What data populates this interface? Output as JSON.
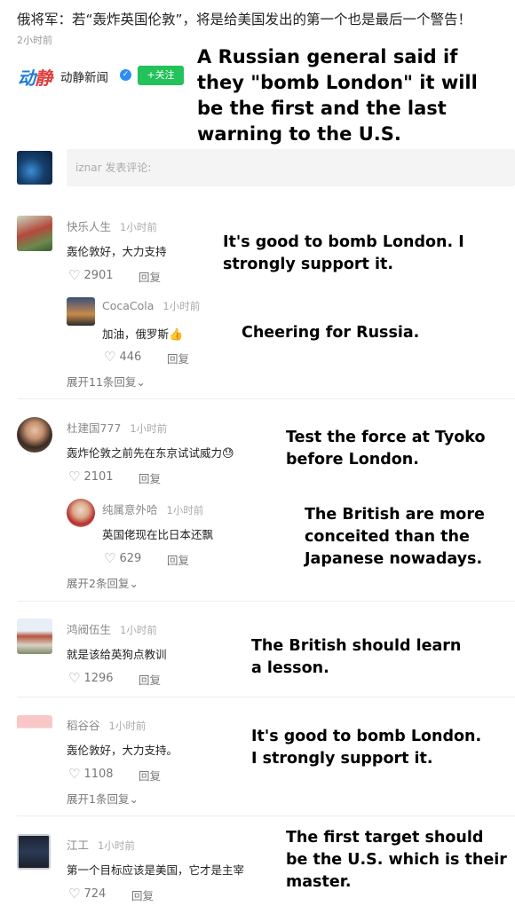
{
  "article": {
    "headline": "俄将军：若“轰炸英国伦敦”，将是给美国发出的第一个也是最后一个警告！",
    "time_ago": "2小时前",
    "source_logo_a": "动",
    "source_logo_b": "静",
    "source_name": "动静新闻",
    "verified_mark": "✓",
    "follow_label": "+关注",
    "caption": "A Russian general said if they \"bomb London\" it will be the first and the last warning to the U.S."
  },
  "comment_input": {
    "placeholder": "iznar 发表评论:"
  },
  "comments": [
    {
      "user": "快乐人生",
      "time": "1小时前",
      "text": "轰伦敦好，大力支持",
      "likes": "2901",
      "reply_label": "回复",
      "caption": "It's good to bomb London. I strongly support it.",
      "replies": [
        {
          "user": "CocaCola",
          "time": "1小时前",
          "text": "加油，俄罗斯",
          "emoji": "👍",
          "likes": "446",
          "reply_label": "回复",
          "caption": "Cheering for Russia."
        }
      ],
      "expand_label": "展开11条回复"
    },
    {
      "user": "杜建国777",
      "time": "1小时前",
      "text": "轰炸伦敦之前先在东京试试威力",
      "emoji": "😓",
      "likes": "2101",
      "reply_label": "回复",
      "caption": "Test the force at Tyoko before London.",
      "replies": [
        {
          "user": "纯属意外哈",
          "time": "1小时前",
          "text": "英国佬现在比日本还飘",
          "likes": "629",
          "reply_label": "回复",
          "caption": "The British are more conceited than the Japanese nowadays."
        }
      ],
      "expand_label": "展开2条回复"
    },
    {
      "user": "鸿阀伍生",
      "time": "1小时前",
      "text": "就是该给英狗点教训",
      "likes": "1296",
      "reply_label": "回复",
      "caption": "The British should learn a lesson."
    },
    {
      "user": "稻谷谷",
      "time": "1小时前",
      "text": "轰伦敦好，大力支持。",
      "likes": "1108",
      "reply_label": "回复",
      "caption": "It's good to bomb London. I strongly support it.",
      "expand_label": "展开1条回复"
    },
    {
      "user": "江工",
      "time": "1小时前",
      "text": "第一个目标应该是美国，它才是主宰",
      "likes": "724",
      "reply_label": "回复",
      "caption": "The first target should be the U.S. which is their master."
    }
  ],
  "icons": {
    "heart": "♡",
    "chevron": "⌄"
  },
  "colors": {
    "follow_green": "#23c25a",
    "verified_blue": "#2f8cf5",
    "logo_blue": "#1f7cd8"
  }
}
